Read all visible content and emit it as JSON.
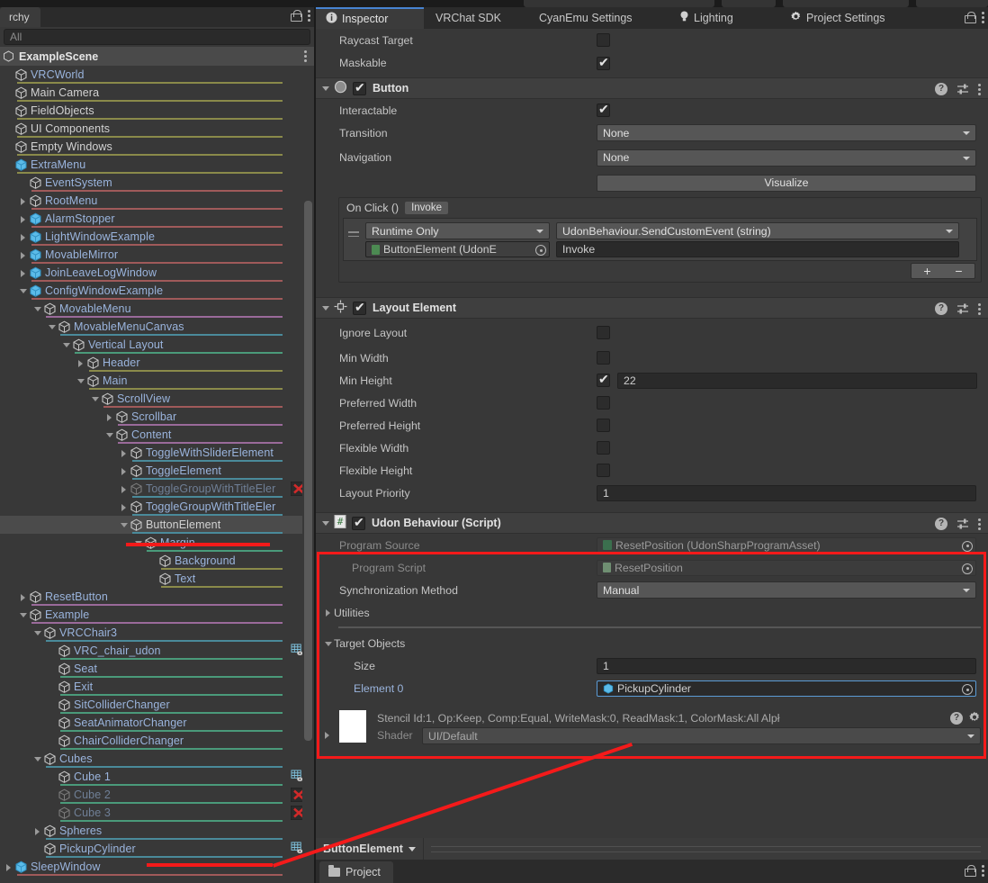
{
  "hierarchy": {
    "tab_label": "rchy",
    "search_placeholder": "All",
    "scene_name": "ExampleScene",
    "items": [
      {
        "label": "VRCWorld",
        "indent": 0,
        "twist": "none",
        "color": "blue",
        "icon": "cube-gray",
        "underline": "#8a8a4a",
        "arrow": false,
        "badge": "none"
      },
      {
        "label": "Main Camera",
        "indent": 0,
        "twist": "none",
        "color": "white",
        "icon": "cube-gray",
        "underline": "#8a8a4a",
        "arrow": false,
        "badge": "none"
      },
      {
        "label": "FieldObjects",
        "indent": 0,
        "twist": "none",
        "color": "white",
        "icon": "cube-gray",
        "underline": "#8a8a4a",
        "arrow": false,
        "badge": "none"
      },
      {
        "label": "UI Components",
        "indent": 0,
        "twist": "none",
        "color": "white",
        "icon": "cube-gray",
        "underline": "#8a8a4a",
        "arrow": false,
        "badge": "none"
      },
      {
        "label": "Empty Windows",
        "indent": 0,
        "twist": "none",
        "color": "white",
        "icon": "cube-gray",
        "underline": "#8a8a4a",
        "arrow": false,
        "badge": "none"
      },
      {
        "label": "ExtraMenu",
        "indent": 0,
        "twist": "none",
        "color": "blue",
        "icon": "cube-blue",
        "underline": "#8a8a4a",
        "arrow": true,
        "badge": "none"
      },
      {
        "label": "EventSystem",
        "indent": 1,
        "twist": "none",
        "color": "blue",
        "icon": "cube-gray",
        "underline": "#a05a5a",
        "arrow": false,
        "badge": "none"
      },
      {
        "label": "RootMenu",
        "indent": 1,
        "twist": "right",
        "color": "blue",
        "icon": "cube-gray",
        "underline": "#a05a5a",
        "arrow": false,
        "badge": "none"
      },
      {
        "label": "AlarmStopper",
        "indent": 1,
        "twist": "right",
        "color": "blue",
        "icon": "cube-blue",
        "underline": "#a05a5a",
        "arrow": true,
        "badge": "none"
      },
      {
        "label": "LightWindowExample",
        "indent": 1,
        "twist": "right",
        "color": "blue",
        "icon": "cube-blue",
        "underline": "#a05a5a",
        "arrow": true,
        "badge": "none"
      },
      {
        "label": "MovableMirror",
        "indent": 1,
        "twist": "right",
        "color": "blue",
        "icon": "cube-blue",
        "underline": "#a05a5a",
        "arrow": true,
        "badge": "none"
      },
      {
        "label": "JoinLeaveLogWindow",
        "indent": 1,
        "twist": "right",
        "color": "blue",
        "icon": "cube-blue",
        "underline": "#a05a5a",
        "arrow": true,
        "badge": "none"
      },
      {
        "label": "ConfigWindowExample",
        "indent": 1,
        "twist": "down",
        "color": "blue",
        "icon": "cube-blue",
        "underline": "#a05a5a",
        "arrow": true,
        "badge": "none"
      },
      {
        "label": "MovableMenu",
        "indent": 2,
        "twist": "down",
        "color": "blue",
        "icon": "cube-gray",
        "underline": "#9a6a9a",
        "arrow": false,
        "badge": "none"
      },
      {
        "label": "MovableMenuCanvas",
        "indent": 3,
        "twist": "down",
        "color": "blue",
        "icon": "cube-gray",
        "underline": "#4a8a9a",
        "arrow": false,
        "badge": "none"
      },
      {
        "label": "Vertical Layout",
        "indent": 4,
        "twist": "down",
        "color": "blue",
        "icon": "cube-gray",
        "underline": "#4a9a7a",
        "arrow": false,
        "badge": "none"
      },
      {
        "label": "Header",
        "indent": 5,
        "twist": "right",
        "color": "blue",
        "icon": "cube-gray",
        "underline": "#8a8a4a",
        "arrow": false,
        "badge": "none"
      },
      {
        "label": "Main",
        "indent": 5,
        "twist": "down",
        "color": "blue",
        "icon": "cube-gray",
        "underline": "#8a8a4a",
        "arrow": false,
        "badge": "none"
      },
      {
        "label": "ScrollView",
        "indent": 6,
        "twist": "down",
        "color": "blue",
        "icon": "cube-gray",
        "underline": "#a05a5a",
        "arrow": false,
        "badge": "none"
      },
      {
        "label": "Scrollbar",
        "indent": 7,
        "twist": "right",
        "color": "blue",
        "icon": "cube-gray",
        "underline": "#9a6a9a",
        "arrow": false,
        "badge": "none"
      },
      {
        "label": "Content",
        "indent": 7,
        "twist": "down",
        "color": "blue",
        "icon": "cube-gray",
        "underline": "#9a6a9a",
        "arrow": false,
        "badge": "none"
      },
      {
        "label": "ToggleWithSliderElement",
        "indent": 8,
        "twist": "right",
        "color": "blue",
        "icon": "cube-gray",
        "underline": "#4a8a9a",
        "arrow": false,
        "badge": "none"
      },
      {
        "label": "ToggleElement",
        "indent": 8,
        "twist": "right",
        "color": "blue",
        "icon": "cube-gray",
        "underline": "#4a8a9a",
        "arrow": false,
        "badge": "none"
      },
      {
        "label": "ToggleGroupWithTitleEler",
        "indent": 8,
        "twist": "right",
        "color": "dim",
        "icon": "cube-dim",
        "underline": "#4a8a9a",
        "arrow": false,
        "badge": "x"
      },
      {
        "label": "ToggleGroupWithTitleEler",
        "indent": 8,
        "twist": "right",
        "color": "blue",
        "icon": "cube-gray",
        "underline": "#4a8a9a",
        "arrow": false,
        "badge": "none"
      },
      {
        "label": "ButtonElement",
        "indent": 8,
        "twist": "down",
        "color": "white",
        "icon": "cube-gray",
        "underline": "#4a8a9a",
        "arrow": false,
        "badge": "none",
        "selected": true
      },
      {
        "label": "Margin",
        "indent": 9,
        "twist": "down",
        "color": "blue",
        "icon": "cube-gray",
        "underline": "#4a9a7a",
        "arrow": false,
        "badge": "none"
      },
      {
        "label": "Background",
        "indent": 10,
        "twist": "none",
        "color": "blue",
        "icon": "cube-gray",
        "underline": "#8a8a4a",
        "arrow": false,
        "badge": "none"
      },
      {
        "label": "Text",
        "indent": 10,
        "twist": "none",
        "color": "blue",
        "icon": "cube-gray",
        "underline": "#8a8a4a",
        "arrow": false,
        "badge": "none"
      },
      {
        "label": "ResetButton",
        "indent": 1,
        "twist": "right",
        "color": "blue",
        "icon": "cube-gray",
        "underline": "#9a6a9a",
        "arrow": false,
        "badge": "none"
      },
      {
        "label": "Example",
        "indent": 1,
        "twist": "down",
        "color": "blue",
        "icon": "cube-gray",
        "underline": "#9a6a9a",
        "arrow": false,
        "badge": "none"
      },
      {
        "label": "VRCChair3",
        "indent": 2,
        "twist": "down",
        "color": "blue",
        "icon": "cube-gray",
        "underline": "#4a8a9a",
        "arrow": false,
        "badge": "none"
      },
      {
        "label": "VRC_chair_udon",
        "indent": 3,
        "twist": "none",
        "color": "blue",
        "icon": "cube-gray",
        "underline": "#4a9a7a",
        "arrow": false,
        "badge": "grid"
      },
      {
        "label": "Seat",
        "indent": 3,
        "twist": "none",
        "color": "blue",
        "icon": "cube-gray",
        "underline": "#4a9a7a",
        "arrow": false,
        "badge": "none"
      },
      {
        "label": "Exit",
        "indent": 3,
        "twist": "none",
        "color": "blue",
        "icon": "cube-gray",
        "underline": "#4a9a7a",
        "arrow": false,
        "badge": "none"
      },
      {
        "label": "SitColliderChanger",
        "indent": 3,
        "twist": "none",
        "color": "blue",
        "icon": "cube-gray",
        "underline": "#4a9a7a",
        "arrow": false,
        "badge": "none"
      },
      {
        "label": "SeatAnimatorChanger",
        "indent": 3,
        "twist": "none",
        "color": "blue",
        "icon": "cube-gray",
        "underline": "#4a9a7a",
        "arrow": false,
        "badge": "none"
      },
      {
        "label": "ChairColliderChanger",
        "indent": 3,
        "twist": "none",
        "color": "blue",
        "icon": "cube-gray",
        "underline": "#4a9a7a",
        "arrow": false,
        "badge": "none"
      },
      {
        "label": "Cubes",
        "indent": 2,
        "twist": "down",
        "color": "blue",
        "icon": "cube-gray",
        "underline": "#4a8a9a",
        "arrow": false,
        "badge": "none"
      },
      {
        "label": "Cube 1",
        "indent": 3,
        "twist": "none",
        "color": "blue",
        "icon": "cube-gray",
        "underline": "#4a9a7a",
        "arrow": false,
        "badge": "grid"
      },
      {
        "label": "Cube 2",
        "indent": 3,
        "twist": "none",
        "color": "dim",
        "icon": "cube-dim",
        "underline": "#4a9a7a",
        "arrow": false,
        "badge": "x"
      },
      {
        "label": "Cube 3",
        "indent": 3,
        "twist": "none",
        "color": "dim",
        "icon": "cube-dim",
        "underline": "#4a9a7a",
        "arrow": false,
        "badge": "x"
      },
      {
        "label": "Spheres",
        "indent": 2,
        "twist": "right",
        "color": "blue",
        "icon": "cube-gray",
        "underline": "#4a8a9a",
        "arrow": false,
        "badge": "none"
      },
      {
        "label": "PickupCylinder",
        "indent": 2,
        "twist": "none",
        "color": "blue",
        "icon": "cube-gray",
        "underline": "#4a8a9a",
        "arrow": false,
        "badge": "grid"
      },
      {
        "label": "SleepWindow",
        "indent": 0,
        "twist": "right",
        "color": "blue",
        "icon": "cube-blue",
        "underline": "#a05a5a",
        "arrow": true,
        "badge": "none"
      }
    ]
  },
  "inspector": {
    "tabs": [
      {
        "label": "Inspector",
        "icon": "info-icon",
        "active": true
      },
      {
        "label": "VRChat SDK",
        "icon": "none",
        "active": false
      },
      {
        "label": "CyanEmu Settings",
        "icon": "none",
        "active": false
      },
      {
        "label": "Lighting",
        "icon": "bulb-icon",
        "active": false
      },
      {
        "label": "Project Settings",
        "icon": "gear-icon",
        "active": false
      }
    ],
    "top_props": [
      {
        "label": "Raycast Target",
        "checked": false
      },
      {
        "label": "Maskable",
        "checked": true
      }
    ],
    "button_component": {
      "title": "Button",
      "enabled": true,
      "interactable_label": "Interactable",
      "interactable_checked": true,
      "transition_label": "Transition",
      "transition_value": "None",
      "navigation_label": "Navigation",
      "navigation_value": "None",
      "visualize_label": "Visualize",
      "onclick_label": "On Click ()",
      "invoke_chip": "Invoke",
      "runtime_value": "Runtime Only",
      "method_value": "UdonBehaviour.SendCustomEvent (string)",
      "object_value": "ButtonElement (UdonE",
      "arg_value": "Invoke",
      "plus_label": "+",
      "minus_label": "−"
    },
    "layout_element": {
      "title": "Layout Element",
      "enabled": true,
      "rows": [
        {
          "label": "Ignore Layout",
          "checked": false,
          "value": null
        },
        {
          "label": "Min Width",
          "checked": false,
          "value": null
        },
        {
          "label": "Min Height",
          "checked": true,
          "value": "22"
        },
        {
          "label": "Preferred Width",
          "checked": false,
          "value": null
        },
        {
          "label": "Preferred Height",
          "checked": false,
          "value": null
        },
        {
          "label": "Flexible Width",
          "checked": false,
          "value": null
        },
        {
          "label": "Flexible Height",
          "checked": false,
          "value": null
        }
      ],
      "priority_label": "Layout Priority",
      "priority_value": "1"
    },
    "udon_behaviour": {
      "title": "Udon Behaviour (Script)",
      "enabled": true,
      "program_source_label": "Program Source",
      "program_source_value": "ResetPosition (UdonSharpProgramAsset)",
      "program_script_label": "Program Script",
      "program_script_value": "ResetPosition",
      "sync_label": "Synchronization Method",
      "sync_value": "Manual",
      "utilities_label": "Utilities",
      "target_objects_label": "Target Objects",
      "size_label": "Size",
      "size_value": "1",
      "element_label": "Element 0",
      "element_value": "PickupCylinder"
    },
    "material": {
      "stencil_text": "Stencil Id:1, Op:Keep, Comp:Equal, WriteMask:0, ReadMask:1, ColorMask:All Alpł",
      "shader_label": "Shader",
      "shader_value": "UI/Default"
    }
  },
  "bottom": {
    "selected_object": "ButtonElement",
    "project_tab": "Project"
  },
  "colors": {
    "accent_tab": "#4784d2",
    "highlight_red": "#f41a1a",
    "hierarchy_blue": "#9ab4dd"
  }
}
